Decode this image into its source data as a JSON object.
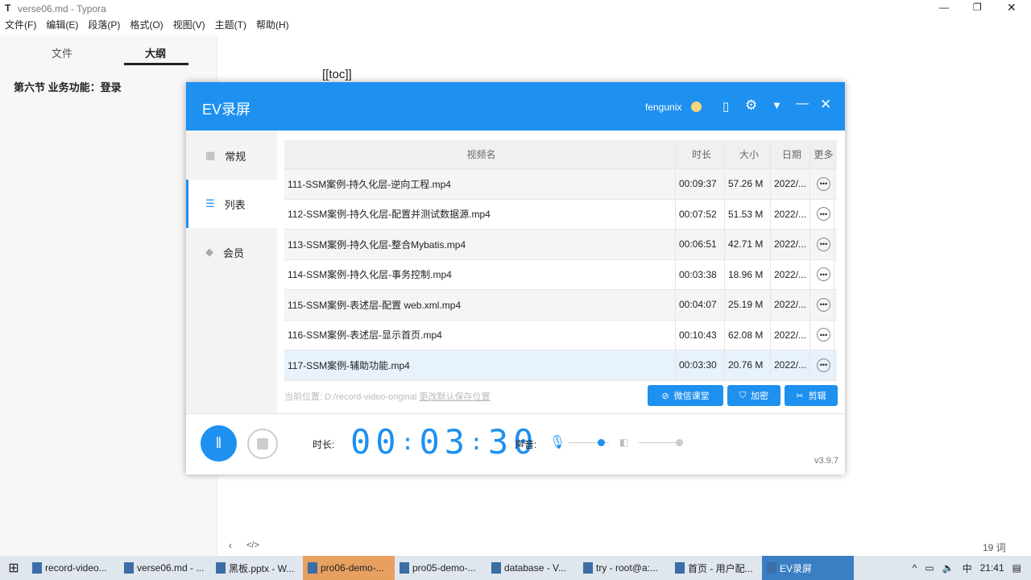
{
  "window": {
    "title": "verse06.md - Typora",
    "app_icon": "T"
  },
  "menu": [
    "文件(F)",
    "编辑(E)",
    "段落(P)",
    "格式(O)",
    "视图(V)",
    "主题(T)",
    "帮助(H)"
  ],
  "sidebar": {
    "tabs": [
      "文件",
      "大纲"
    ],
    "active_tab": "大纲",
    "outline": [
      "第六节 业务功能：登录"
    ]
  },
  "editor": {
    "content": "[[toc]]",
    "word_count": "19 词"
  },
  "ev": {
    "title": "EV录屏",
    "user": "fengunix",
    "nav": [
      {
        "label": "常规"
      },
      {
        "label": "列表"
      },
      {
        "label": "会员"
      }
    ],
    "active_nav": "列表",
    "columns": [
      "视频名",
      "时长",
      "大小",
      "日期",
      "更多"
    ],
    "rows": [
      {
        "name": "111-SSM案例-持久化层-逆向工程.mp4",
        "dur": "00:09:37",
        "size": "57.26 M",
        "date": "2022/..."
      },
      {
        "name": "112-SSM案例-持久化层-配置并测试数据源.mp4",
        "dur": "00:07:52",
        "size": "51.53 M",
        "date": "2022/..."
      },
      {
        "name": "113-SSM案例-持久化层-整合Mybatis.mp4",
        "dur": "00:06:51",
        "size": "42.71 M",
        "date": "2022/..."
      },
      {
        "name": "114-SSM案例-持久化层-事务控制.mp4",
        "dur": "00:03:38",
        "size": "18.96 M",
        "date": "2022/..."
      },
      {
        "name": "115-SSM案例-表述层-配置 web.xml.mp4",
        "dur": "00:04:07",
        "size": "25.19 M",
        "date": "2022/..."
      },
      {
        "name": "116-SSM案例-表述层-显示首页.mp4",
        "dur": "00:10:43",
        "size": "62.08 M",
        "date": "2022/..."
      },
      {
        "name": "117-SSM案例-辅助功能.mp4",
        "dur": "00:03:30",
        "size": "20.76 M",
        "date": "2022/..."
      }
    ],
    "location_label": "当前位置:",
    "location": "D:/record-video-original",
    "change_location": "更改默认保存位置",
    "buttons": [
      "微信课堂",
      "加密",
      "剪辑"
    ],
    "duration_label": "时长:",
    "timer": [
      "00",
      "03",
      "30"
    ],
    "sound_label": "声音:",
    "mic_level": 0.8,
    "speaker_level": 1.0,
    "version": "v3.9.7"
  },
  "taskbar": {
    "items": [
      "record-video...",
      "verse06.md - ...",
      "黑板.pptx - W...",
      "pro06-demo-...",
      "pro05-demo-...",
      "database - V...",
      "try - root@a:...",
      "首页 - 用户配...",
      "EV录屏"
    ],
    "active": "pro06-demo-...",
    "ime": "中",
    "time": "21:41"
  }
}
